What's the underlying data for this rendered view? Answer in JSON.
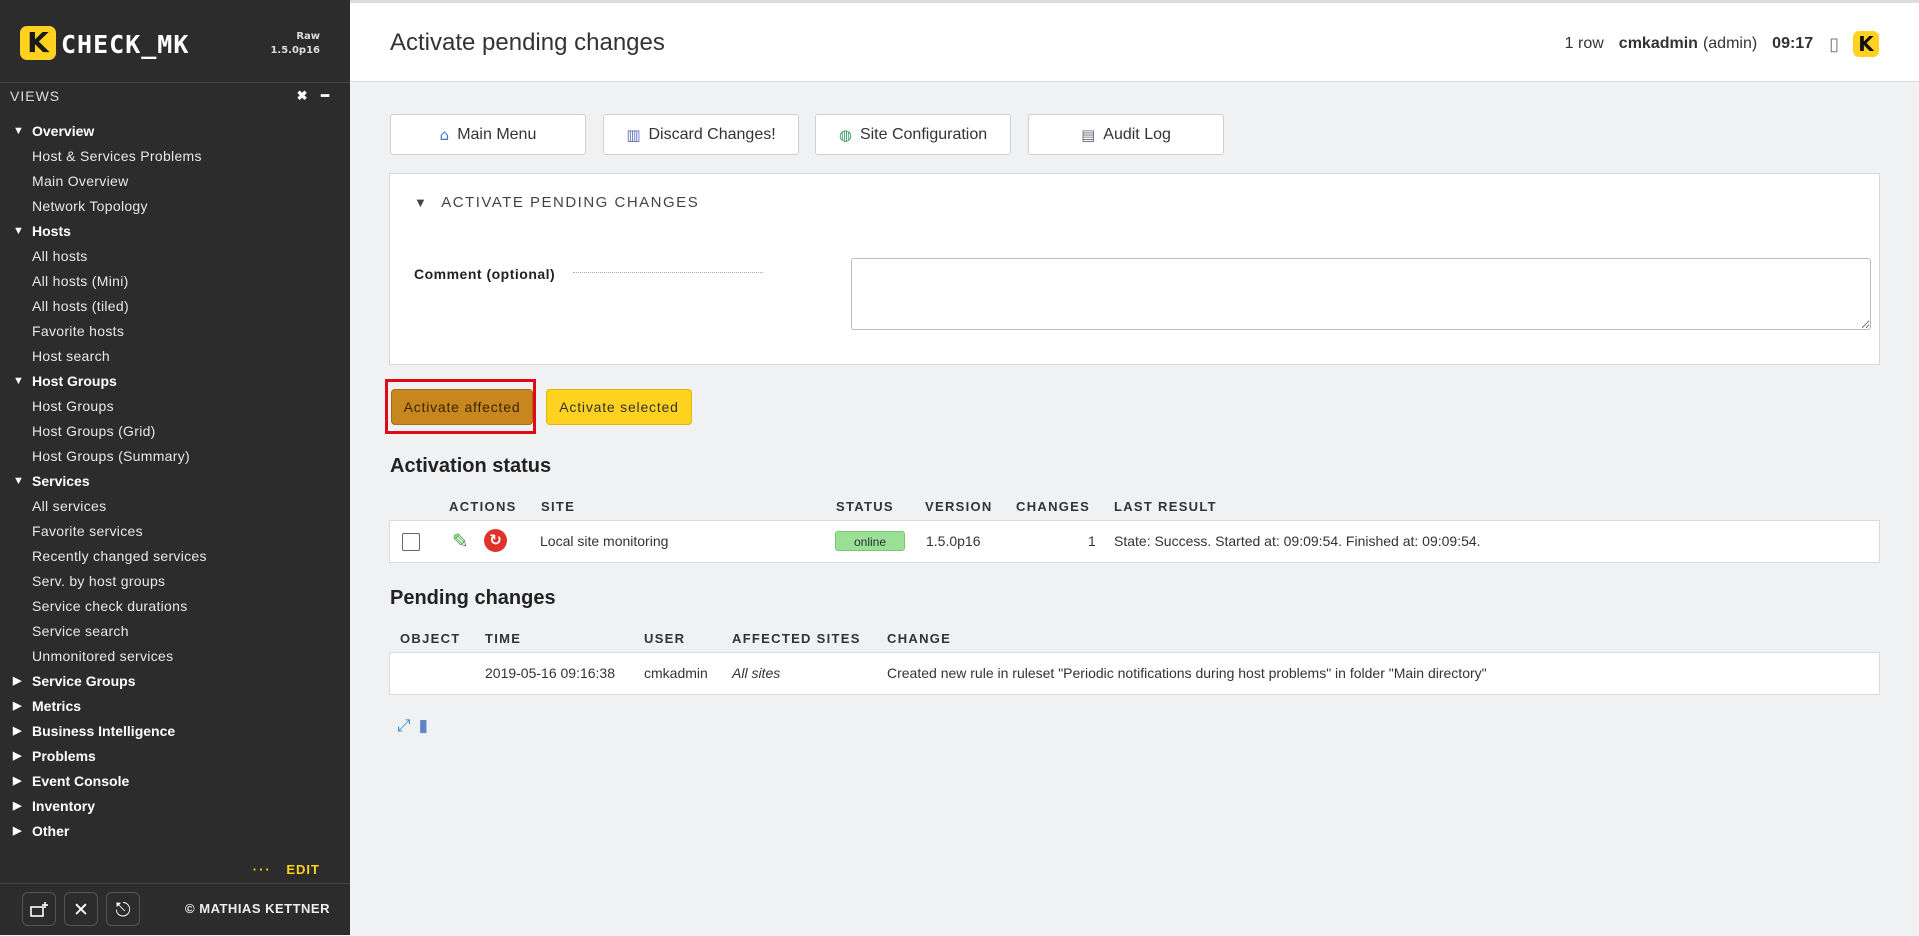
{
  "sidebar": {
    "logo_letter": "K",
    "logo_text": "CHECK_MK",
    "edition": "Raw",
    "version": "1.5.0p16",
    "views_label": "VIEWS",
    "views_close": "✖",
    "views_minimize": "━",
    "sections": [
      {
        "label": "Overview",
        "expanded": true,
        "items": [
          "Host & Services Problems",
          "Main Overview",
          "Network Topology"
        ]
      },
      {
        "label": "Hosts",
        "expanded": true,
        "items": [
          "All hosts",
          "All hosts (Mini)",
          "All hosts (tiled)",
          "Favorite hosts",
          "Host search"
        ]
      },
      {
        "label": "Host Groups",
        "expanded": true,
        "items": [
          "Host Groups",
          "Host Groups (Grid)",
          "Host Groups (Summary)"
        ]
      },
      {
        "label": "Services",
        "expanded": true,
        "items": [
          "All services",
          "Favorite services",
          "Recently changed services",
          "Serv. by host groups",
          "Service check durations",
          "Service search",
          "Unmonitored services"
        ]
      },
      {
        "label": "Service Groups",
        "expanded": false,
        "items": []
      },
      {
        "label": "Metrics",
        "expanded": false,
        "items": []
      },
      {
        "label": "Business Intelligence",
        "expanded": false,
        "items": []
      },
      {
        "label": "Problems",
        "expanded": false,
        "items": []
      },
      {
        "label": "Event Console",
        "expanded": false,
        "items": []
      },
      {
        "label": "Inventory",
        "expanded": false,
        "items": []
      },
      {
        "label": "Other",
        "expanded": false,
        "items": []
      }
    ],
    "edit_dots": "···",
    "edit_label": "EDIT",
    "copyright": "© MATHIAS KETTNER"
  },
  "header": {
    "title": "Activate pending changes",
    "row_count": "1 row",
    "username": "cmkadmin",
    "role": "(admin)",
    "time": "09:17",
    "logo_letter": "K"
  },
  "menu_buttons": [
    {
      "icon": "home-icon",
      "label": "Main Menu"
    },
    {
      "icon": "trash-icon",
      "label": "Discard Changes!"
    },
    {
      "icon": "globe-icon",
      "label": "Site Configuration"
    },
    {
      "icon": "clipboard-icon",
      "label": "Audit Log"
    }
  ],
  "form": {
    "header": "ACTIVATE PENDING CHANGES",
    "comment_label": "Comment (optional)",
    "comment_value": ""
  },
  "actions": {
    "activate_affected": "Activate affected",
    "activate_selected": "Activate selected"
  },
  "activation_status": {
    "title": "Activation status",
    "columns": [
      "ACTIONS",
      "SITE",
      "STATUS",
      "VERSION",
      "CHANGES",
      "LAST RESULT"
    ],
    "rows": [
      {
        "site": "Local site monitoring",
        "status": "online",
        "version": "1.5.0p16",
        "changes": "1",
        "last_result": "State: Success. Started at: 09:09:54. Finished at: 09:09:54."
      }
    ]
  },
  "pending_changes": {
    "title": "Pending changes",
    "columns": [
      "OBJECT",
      "TIME",
      "USER",
      "AFFECTED SITES",
      "CHANGE"
    ],
    "rows": [
      {
        "object": "",
        "time": "2019-05-16 09:16:38",
        "user": "cmkadmin",
        "affected_sites": "All sites",
        "change": "Created new rule in ruleset \"Periodic notifications during host problems\" in folder \"Main directory\""
      }
    ]
  },
  "colors": {
    "brand_yellow": "#ffd21f",
    "activate_affected_bg": "#c8861f",
    "online_badge": "#9be094",
    "highlight_border": "#e30a17"
  }
}
